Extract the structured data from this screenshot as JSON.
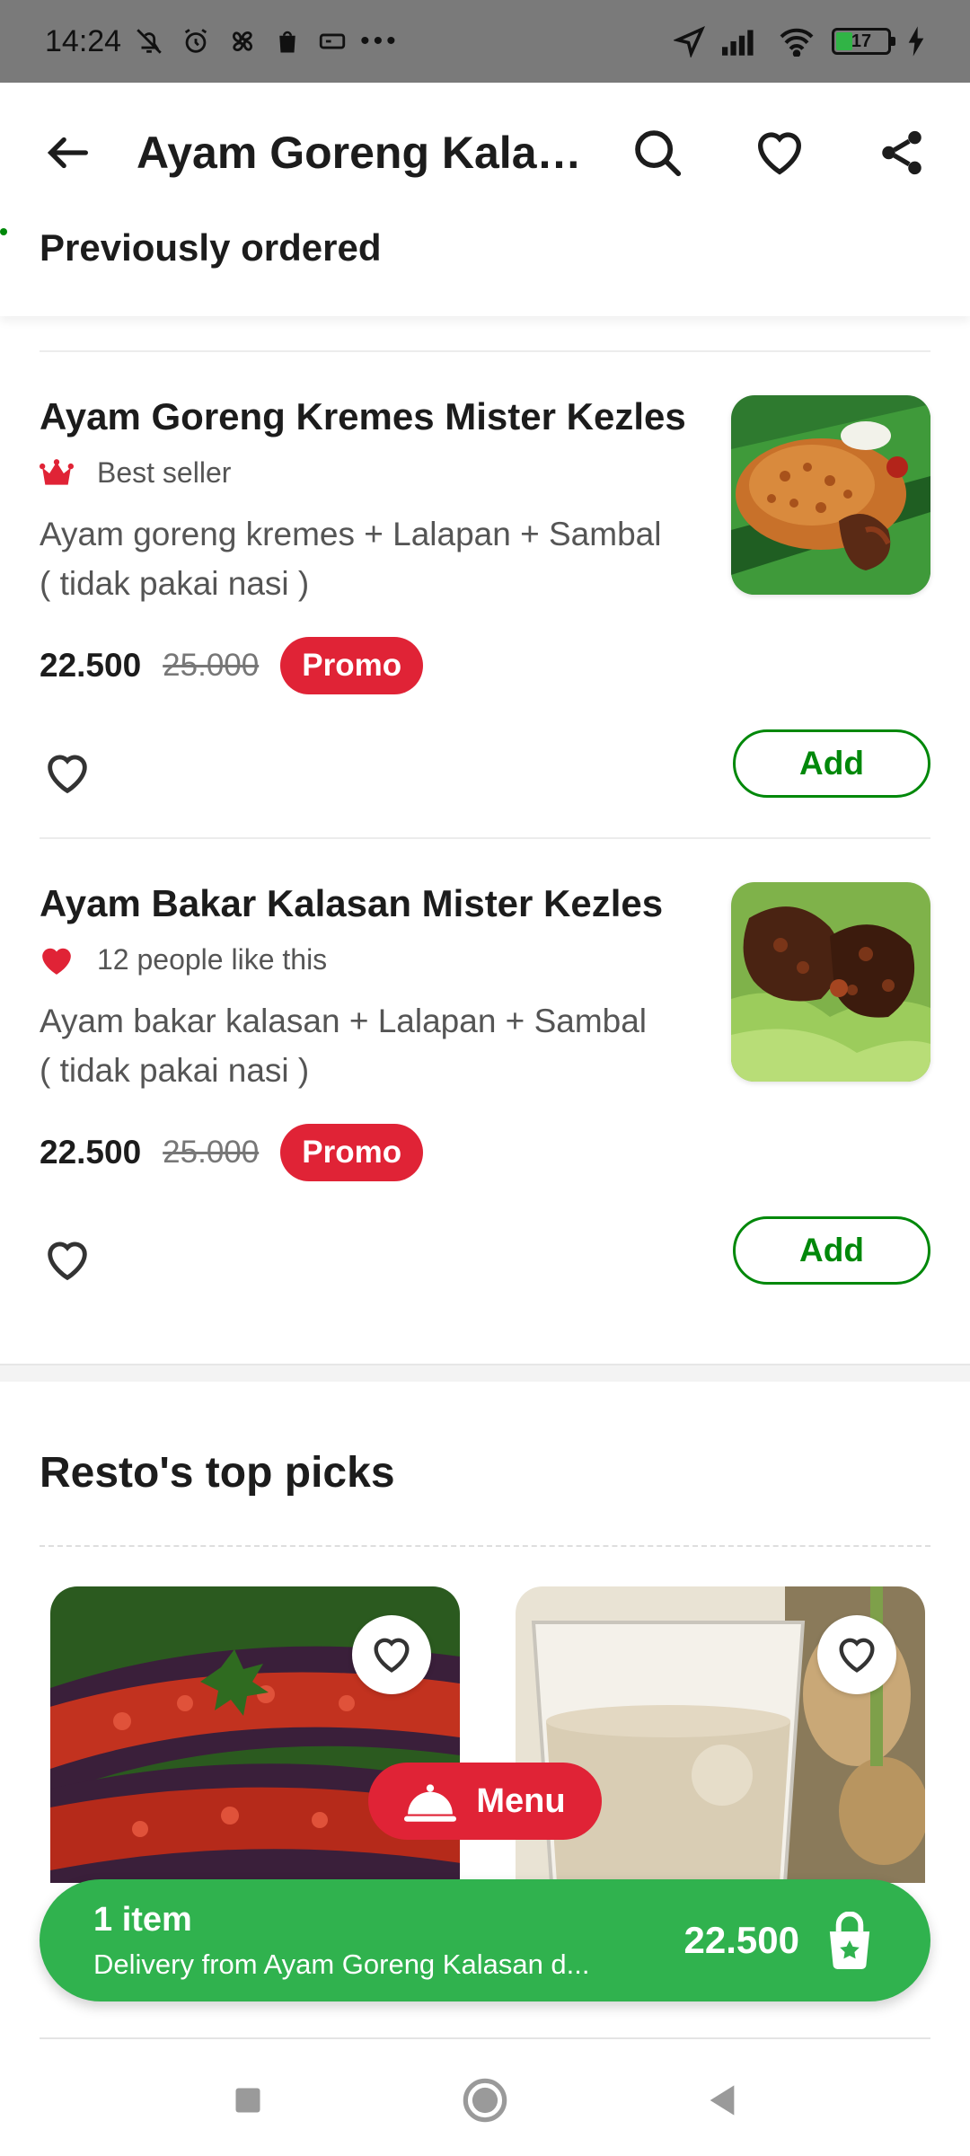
{
  "status_bar": {
    "time": "14:24",
    "battery": "17"
  },
  "header": {
    "title": "Ayam Goreng Kalasan Mister Kezles",
    "section": "Previously ordered"
  },
  "items": [
    {
      "name": "Ayam Goreng Kremes Mister Kezles",
      "badge": "Best seller",
      "badge_icon": "crown-icon",
      "desc_line1": "Ayam goreng kremes + Lalapan + Sambal",
      "desc_line2": "( tidak pakai nasi )",
      "price": "22.500",
      "old_price": "25.000",
      "promo": "Promo",
      "add": "Add"
    },
    {
      "name": "Ayam Bakar Kalasan Mister Kezles",
      "badge": "12 people like this",
      "badge_icon": "heart-filled-icon",
      "desc_line1": "Ayam bakar kalasan + Lalapan + Sambal",
      "desc_line2": "( tidak pakai nasi )",
      "price": "22.500",
      "old_price": "25.000",
      "promo": "Promo",
      "add": "Add"
    }
  ],
  "top_picks": {
    "title": "Resto's top picks"
  },
  "menu_button": {
    "label": "Menu"
  },
  "cart": {
    "count": "1 item",
    "subtitle": "Delivery from Ayam Goreng Kalasan d...",
    "total": "22.500"
  },
  "colors": {
    "green": "#00880a",
    "cart_green": "#30b24e",
    "red": "#e02336"
  }
}
